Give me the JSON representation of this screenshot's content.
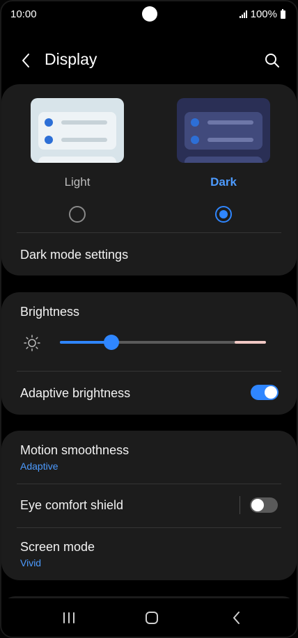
{
  "status_bar": {
    "time": "10:00",
    "battery": "100%",
    "icons": [
      "signal-icon",
      "battery-icon"
    ]
  },
  "header": {
    "title": "Display",
    "back_icon": "back-arrow-icon",
    "search_icon": "search-icon"
  },
  "theme": {
    "options": [
      {
        "label": "Light",
        "selected": false
      },
      {
        "label": "Dark",
        "selected": true
      }
    ],
    "dark_mode_settings": "Dark mode settings"
  },
  "brightness": {
    "title": "Brightness",
    "icon": "sun-icon",
    "level": 0.25,
    "adaptive_label": "Adaptive brightness",
    "adaptive_on": true
  },
  "settings": {
    "motion_smoothness": {
      "title": "Motion smoothness",
      "value": "Adaptive"
    },
    "eye_comfort": {
      "title": "Eye comfort shield",
      "on": false
    },
    "screen_mode": {
      "title": "Screen mode",
      "value": "Vivid"
    }
  },
  "nav_bar": {
    "icons": [
      "recents-icon",
      "home-icon",
      "back-icon"
    ]
  },
  "colors": {
    "accent": "#2f86ff",
    "background": "#000000",
    "card": "#1c1c1c",
    "subtext_blue": "#4d9bff"
  }
}
